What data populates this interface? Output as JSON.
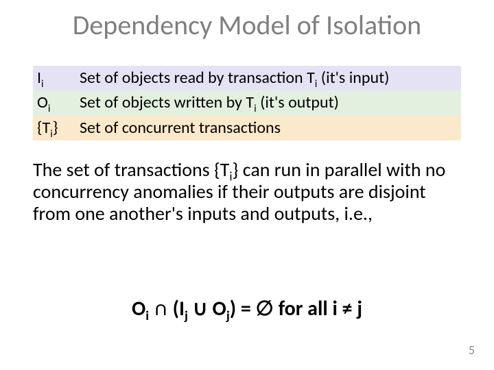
{
  "title": "Dependency Model of Isolation",
  "defs": {
    "row1": {
      "sym_html": "I<sub>i</sub>",
      "desc_html": "Set of objects read by transaction T<sub>i</sub> (it's input)"
    },
    "row2": {
      "sym_html": "O<sub>i</sub>",
      "desc_html": "Set of objects written by T<sub>i</sub> (it's output)"
    },
    "row3": {
      "sym_html": "{T<sub>i</sub>}",
      "desc_html": "Set of concurrent transactions"
    }
  },
  "body_html": "The set of transactions {T<sub>i</sub>} can run in parallel with no concurrency anomalies if their outputs are disjoint from one another's inputs and outputs, i.e.,",
  "formula_html": "O<sub>i</sub> ∩ (I<sub>j</sub> ∪ O<sub>j</sub>) = ∅ for all i ≠ j",
  "page_number": "5"
}
